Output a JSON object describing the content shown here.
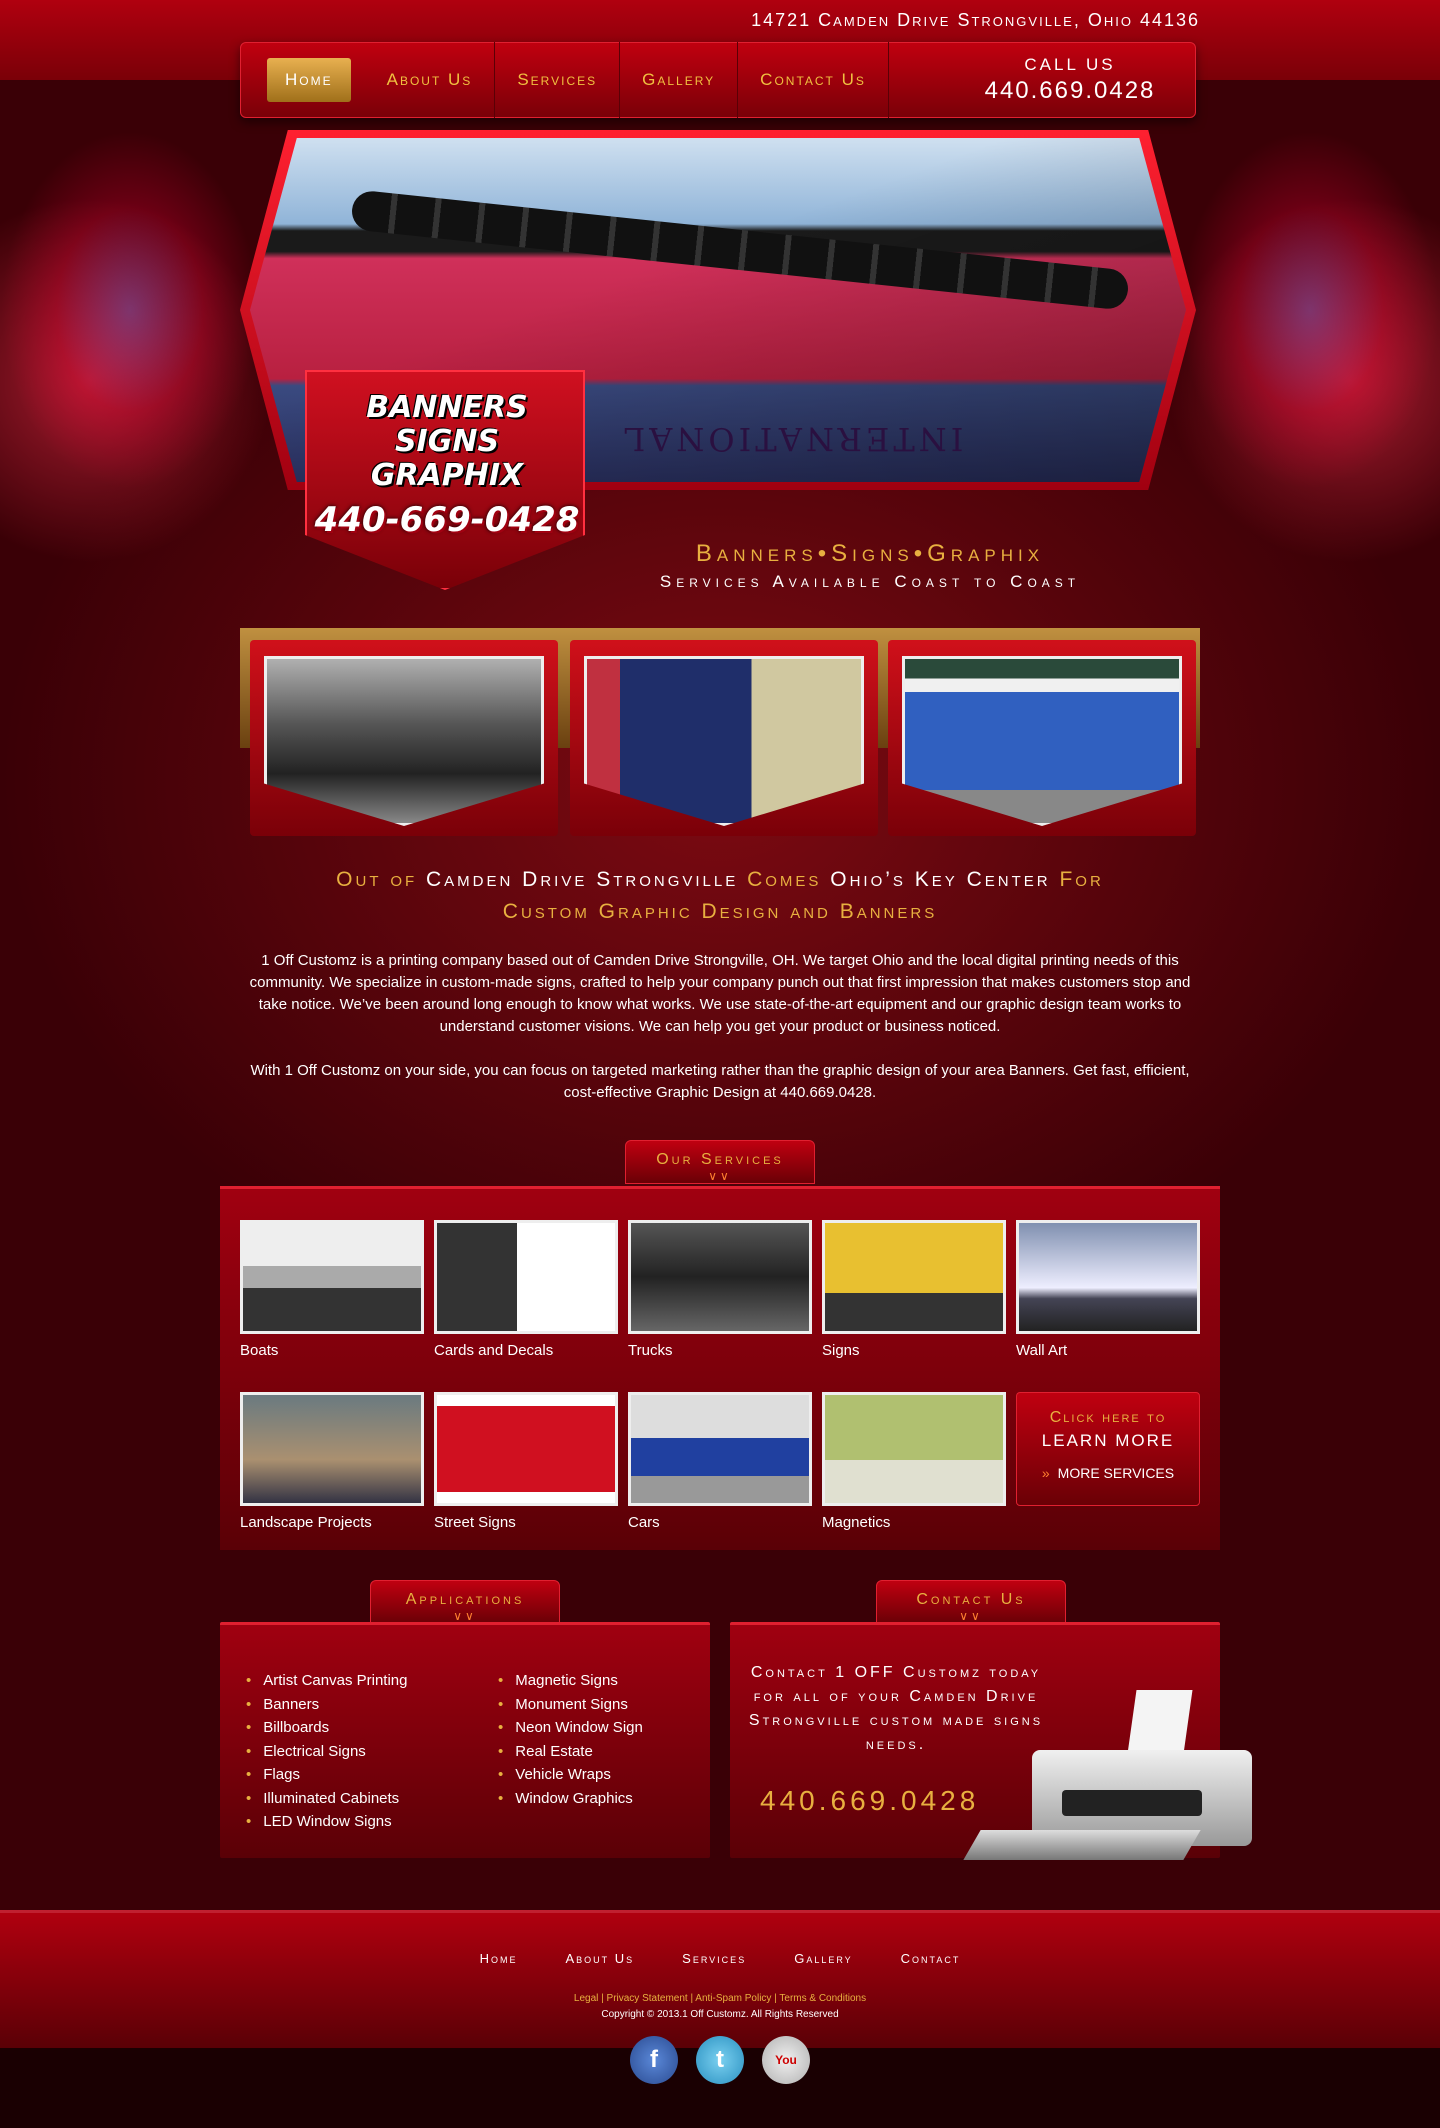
{
  "header": {
    "address": "14721 Camden Drive Strongville, Ohio 44136",
    "nav": [
      "Home",
      "About Us",
      "Services",
      "Gallery",
      "Contact Us"
    ],
    "call_label": "CALL US",
    "call_number": "440.669.0428"
  },
  "hero": {
    "print_text": "INTERNATIONAL",
    "logo_lines": [
      "BANNERS",
      "SIGNS",
      "GRAPHIX",
      "440-669-0428"
    ],
    "tagline_1": "Banners•Signs•Graphix",
    "tagline_2": "Services Available Coast to Coast"
  },
  "intro": {
    "heading_1a": "Out of",
    "heading_1b": "Camden Drive Strongville",
    "heading_1c": "Comes",
    "heading_1d": "Ohio’s Key Center",
    "heading_1e": "For",
    "heading_2": "Custom Graphic Design and Banners",
    "p1": "1 Off Customz is a printing company based out of Camden Drive Strongville, OH. We target Ohio and the local digital printing needs of this community. We specialize in custom-made signs, crafted to help your company punch out that first impression that makes customers stop and take notice. We’ve been around long enough to know what works. We use state-of-the-art equipment and our graphic design team works to understand customer visions. We can help you get your product or business noticed.",
    "p2": "With 1 Off Customz on your side, you can focus on targeted marketing rather than the graphic design of your area Banners. Get fast, efficient, cost-effective Graphic Design at 440.669.0428."
  },
  "services": {
    "title": "Our Services",
    "items": [
      "Boats",
      "Cards and Decals",
      "Trucks",
      "Signs",
      "Wall Art",
      "Landscape Projects",
      "Street Signs",
      "Cars",
      "Magnetics"
    ],
    "learn_1": "Click here to",
    "learn_2": "LEARN MORE",
    "learn_3": "MORE SERVICES"
  },
  "applications": {
    "title": "Applications",
    "col1": [
      "Artist Canvas Printing",
      "Banners",
      "Billboards",
      "Electrical Signs",
      "Flags",
      "Illuminated Cabinets",
      "LED Window Signs"
    ],
    "col2": [
      "Magnetic Signs",
      "Monument Signs",
      "Neon Window Sign",
      "Real Estate",
      "Vehicle Wraps",
      "Window Graphics"
    ]
  },
  "contact": {
    "title": "Contact Us",
    "text": "Contact 1 OFF Customz today for all of your Camden Drive Strongville custom made signs needs.",
    "phone": "440.669.0428"
  },
  "footer": {
    "nav": [
      "Home",
      "About Us",
      "Services",
      "Gallery",
      "Contact"
    ],
    "legal": "Legal | Privacy Statement | Anti-Spam Policy | Terms & Conditions",
    "copyright": "Copyright © 2013.1 Off Customz. All Rights Reserved",
    "social": [
      "facebook-icon",
      "twitter-icon",
      "youtube-icon"
    ]
  }
}
